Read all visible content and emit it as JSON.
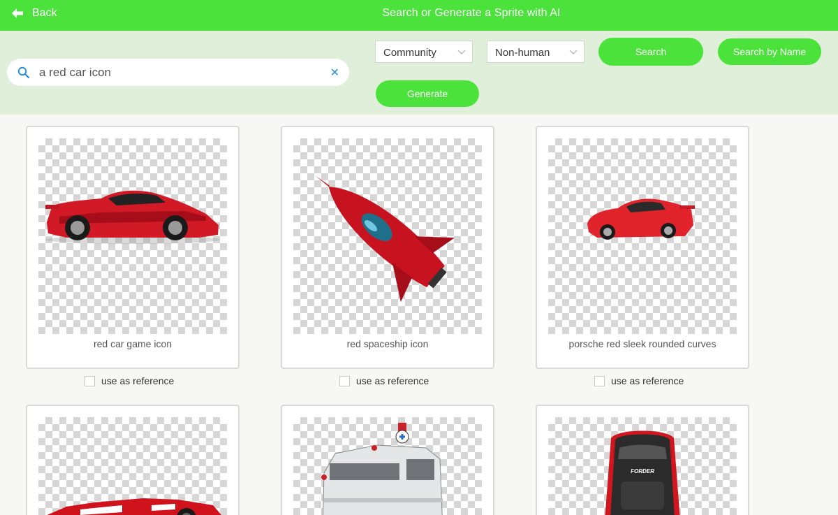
{
  "header": {
    "back_label": "Back",
    "title": "Search or Generate a Sprite with AI"
  },
  "search": {
    "value": "a red car icon",
    "placeholder": "",
    "clear_label": "✕"
  },
  "filters": {
    "source": "Community",
    "type": "Non-human"
  },
  "buttons": {
    "search": "Search",
    "search_by_name": "Search by Name",
    "generate": "Generate"
  },
  "results": [
    {
      "caption": "red car game icon",
      "reference_label": "use as reference",
      "icon": "red-sports-car"
    },
    {
      "caption": "red spaceship icon",
      "reference_label": "use as reference",
      "icon": "red-spaceship"
    },
    {
      "caption": "porsche red sleek rounded curves",
      "reference_label": "use as reference",
      "icon": "red-porsche"
    },
    {
      "caption": "",
      "reference_label": "",
      "icon": "red-race-car"
    },
    {
      "caption": "",
      "reference_label": "",
      "icon": "ambulance-truck"
    },
    {
      "caption": "",
      "reference_label": "",
      "icon": "black-car-top-view",
      "badge_text": "FORDER"
    }
  ],
  "colors": {
    "brand_green": "#4be33b",
    "toolbar_bg": "#dfefd9",
    "accent_blue": "#2a8ee0"
  }
}
